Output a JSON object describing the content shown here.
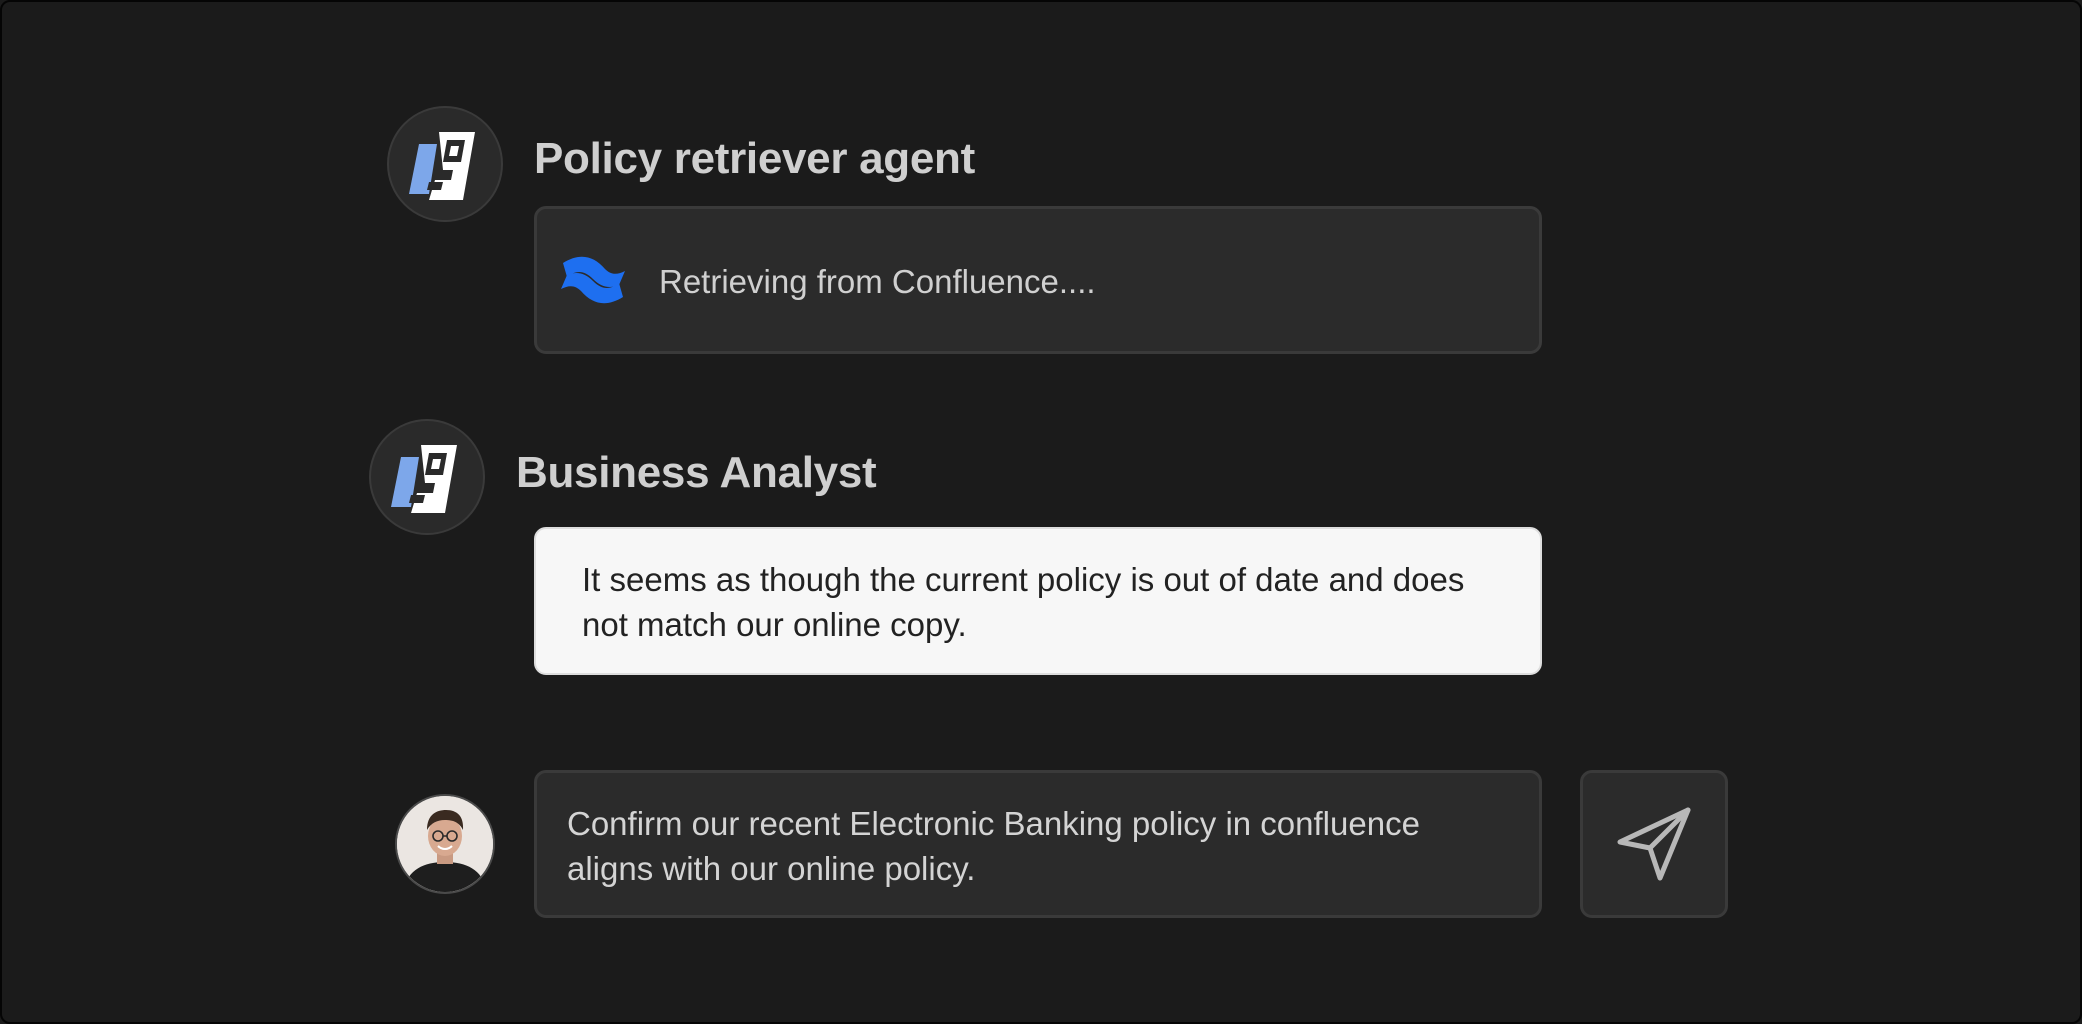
{
  "agents": [
    {
      "name": "Policy retriever agent",
      "avatar_icon": "agent-logo-icon",
      "status": {
        "icon": "confluence-logo-icon",
        "text": "Retrieving from Confluence...."
      }
    },
    {
      "name": "Business Analyst",
      "avatar_icon": "agent-logo-icon",
      "message": {
        "line1": "It seems as though the current policy is out of date and does",
        "line2": "not match our online copy."
      }
    }
  ],
  "composer": {
    "user_avatar": "user-avatar-photo",
    "line1": "Confirm our recent Electronic Banking policy in confluence",
    "line2": "aligns with our online policy.",
    "send_icon": "send-icon"
  },
  "colors": {
    "background": "#1b1b1b",
    "card": "#2b2b2b",
    "card_border": "#3a3a3a",
    "message_bg": "#f7f7f7",
    "logo_blue": "#7da7ea",
    "confluence_blue": "#1e6ff0"
  }
}
